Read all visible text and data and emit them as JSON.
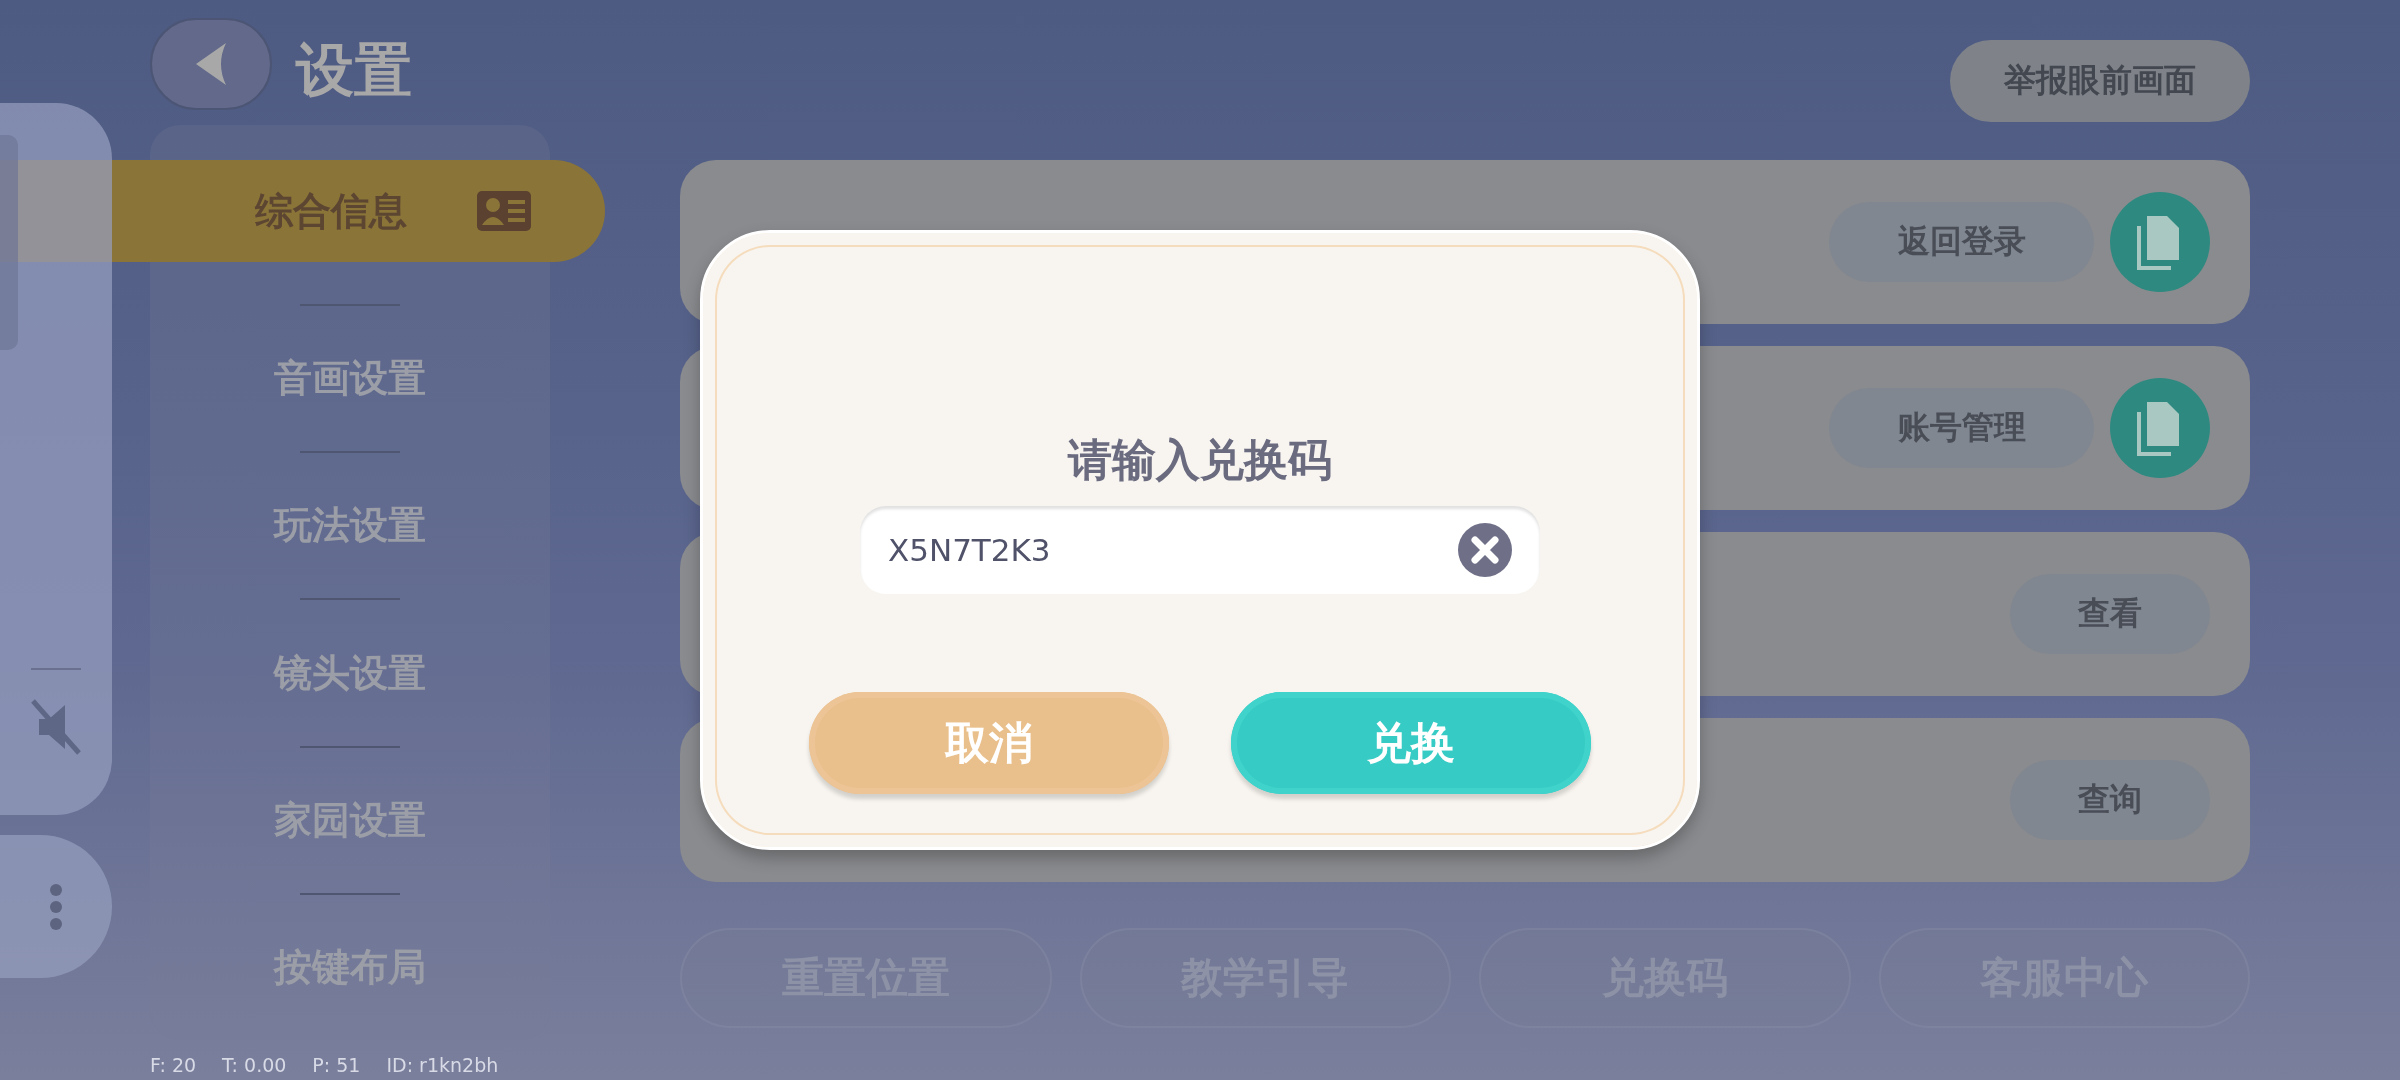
{
  "header": {
    "title": "设置",
    "report_button": "举报眼前画面"
  },
  "side_controls": {
    "muted": true
  },
  "sidebar": {
    "items": [
      {
        "label": "综合信息",
        "selected": true
      },
      {
        "label": "音画设置",
        "selected": false
      },
      {
        "label": "玩法设置",
        "selected": false
      },
      {
        "label": "镜头设置",
        "selected": false
      },
      {
        "label": "家园设置",
        "selected": false
      },
      {
        "label": "按键布局",
        "selected": false
      }
    ]
  },
  "rows": [
    {
      "kind": "copy",
      "button": "返回登录"
    },
    {
      "kind": "copy",
      "button": "账号管理"
    },
    {
      "kind": "plain",
      "button": "查看"
    },
    {
      "kind": "plain",
      "button": "查询"
    }
  ],
  "bottom_buttons": [
    "重置位置",
    "教学引导",
    "兑换码",
    "客服中心"
  ],
  "status": [
    "F: 20",
    "T: 0.00",
    "P: 51",
    "ID: r1kn2bh"
  ],
  "dialog": {
    "title": "请输入兑换码",
    "code": "X5N7T2K3",
    "buttons": [
      {
        "label": "取消",
        "kind": "cancel"
      },
      {
        "label": "兑换",
        "kind": "confirm"
      }
    ]
  }
}
